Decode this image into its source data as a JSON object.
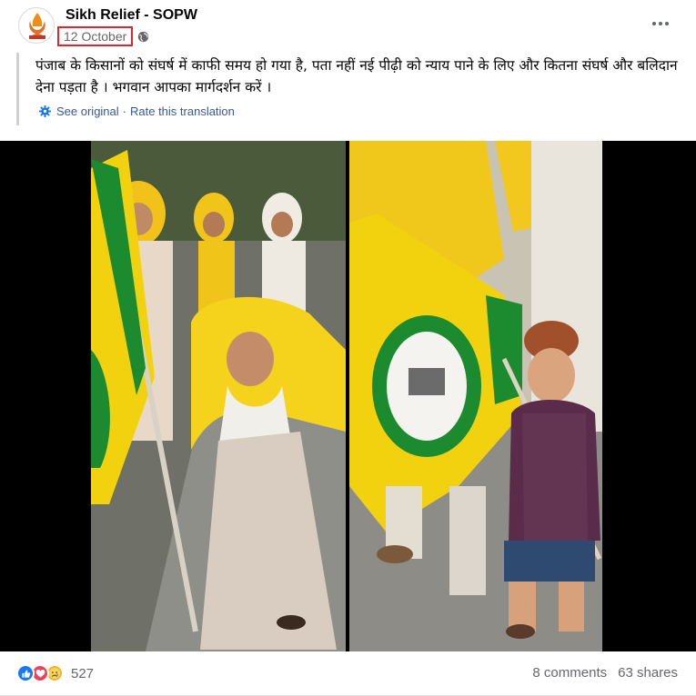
{
  "post": {
    "page_name": "Sikh Relief - SOPW",
    "date": "12 October",
    "avatar_text": "SIKH RELIEF",
    "text": "पंजाब के किसानों को संघर्ष में काफी समय हो गया है, पता नहीं नई पीढ़ी को न्याय पाने के लिए और कितना संघर्ष और बलिदान देना पड़ता है । भगवान आपका मार्गदर्शन करें ।",
    "see_original": "See original",
    "separator": "·",
    "rate_translation": "Rate this translation"
  },
  "icons": {
    "privacy": "globe-icon",
    "translation": "gear-icon",
    "menu": "more-icon"
  },
  "footer": {
    "reaction_count": "527",
    "comments": "8 comments",
    "shares": "63 shares"
  },
  "colors": {
    "highlight_box": "#e0262b",
    "link": "#385898",
    "like": "#1877f2",
    "love": "#f33e58",
    "sad": "#f7b125",
    "flag_yellow": "#f2d20f",
    "flag_green": "#1c8a2e"
  }
}
